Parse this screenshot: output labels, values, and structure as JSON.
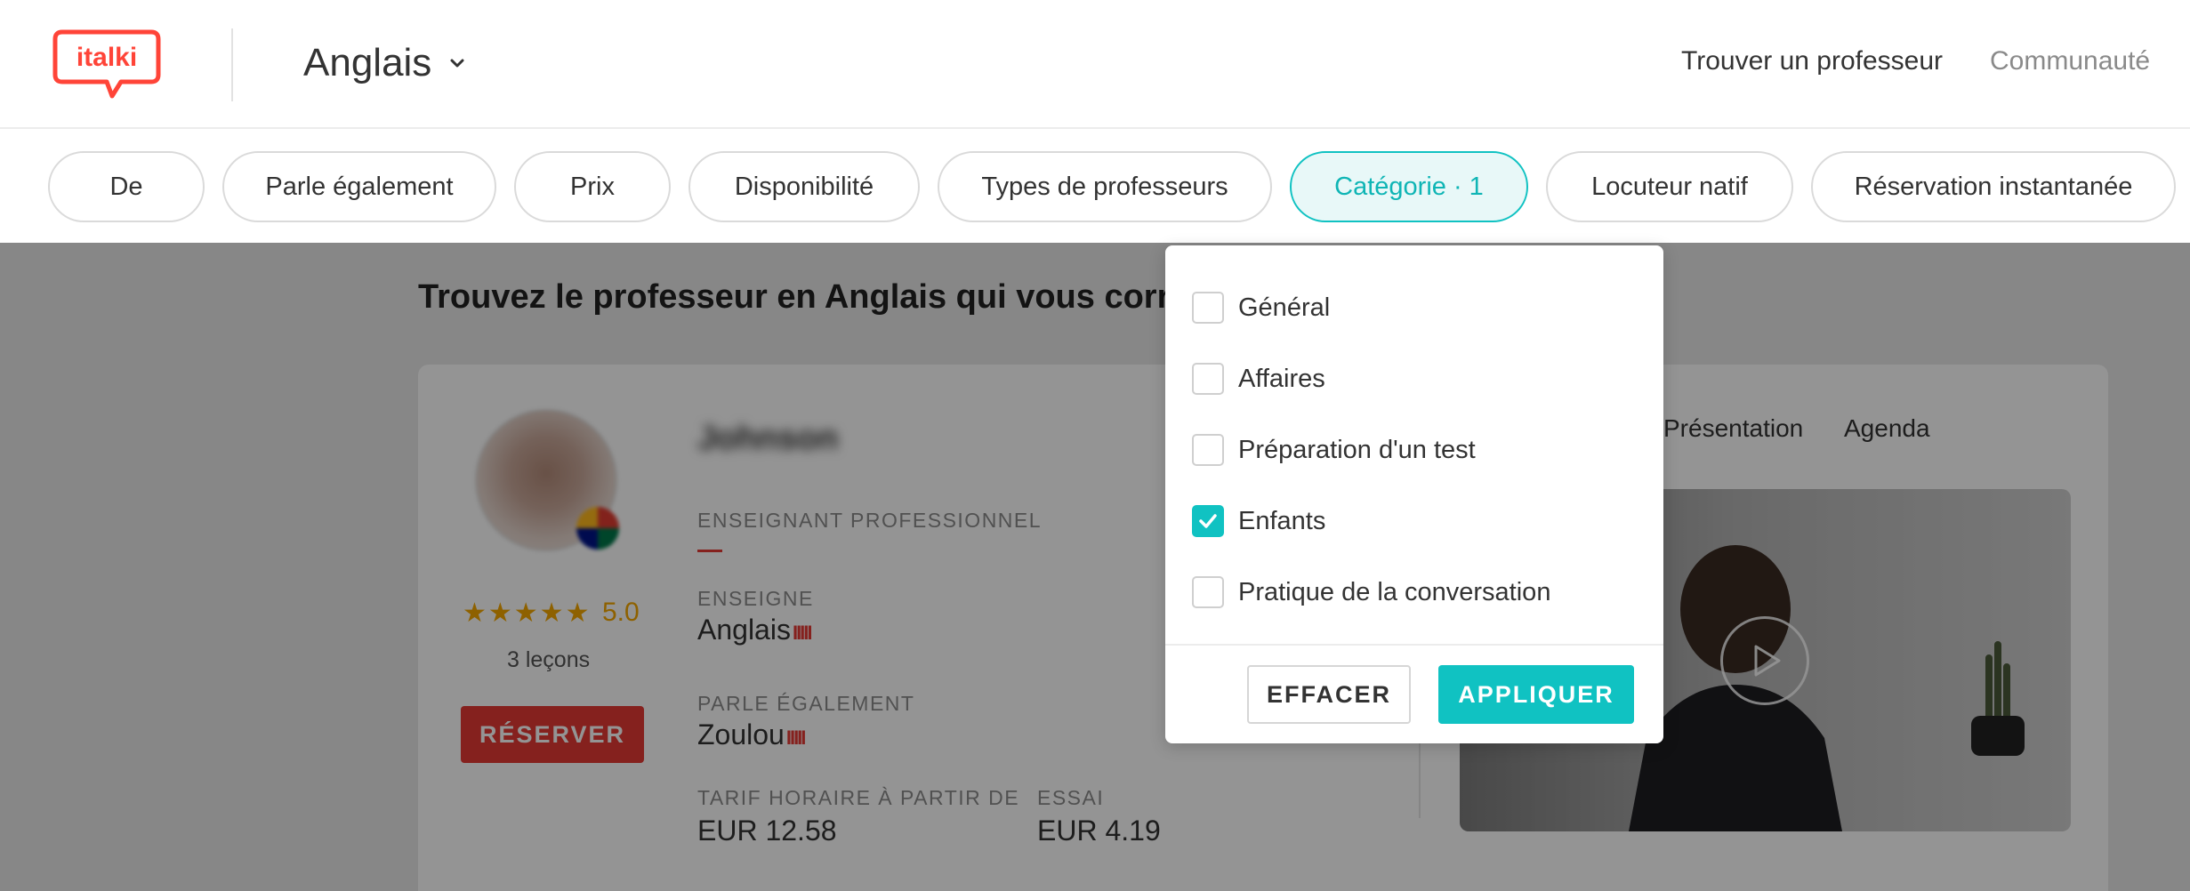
{
  "header": {
    "logo_text": "italki",
    "language": "Anglais",
    "nav": {
      "find_teacher": "Trouver un professeur",
      "community": "Communauté"
    }
  },
  "filters": [
    {
      "label": "De",
      "active": false
    },
    {
      "label": "Parle également",
      "active": false
    },
    {
      "label": "Prix",
      "active": false
    },
    {
      "label": "Disponibilité",
      "active": false
    },
    {
      "label": "Types de professeurs",
      "active": false
    },
    {
      "label": "Catégorie · 1",
      "active": true
    },
    {
      "label": "Locuteur natif",
      "active": false
    },
    {
      "label": "Réservation instantanée",
      "active": false
    }
  ],
  "main": {
    "heading": "Trouvez le professeur en Anglais qui vous corres",
    "teacher": {
      "name": "Johnson",
      "stars": "★★★★★",
      "rating": "5.0",
      "lessons": "3 leçons",
      "reserve_label": "RÉSERVER",
      "type_label": "ENSEIGNANT PROFESSIONNEL",
      "teaches_label": "ENSEIGNE",
      "teaches_value": "Anglais",
      "speaks_label": "PARLE ÉGALEMENT",
      "speaks_value": "Zoulou",
      "level_bars": "IIIII",
      "rate_label": "TARIF HORAIRE À PARTIR DE",
      "rate_value": "EUR 12.58",
      "trial_label": "ESSAI",
      "trial_value": "EUR 4.19",
      "tabs": {
        "presentation": "Présentation",
        "agenda": "Agenda"
      }
    }
  },
  "category_dropdown": {
    "options": [
      {
        "label": "Général",
        "checked": false
      },
      {
        "label": "Affaires",
        "checked": false
      },
      {
        "label": "Préparation d'un test",
        "checked": false
      },
      {
        "label": "Enfants",
        "checked": true
      },
      {
        "label": "Pratique de la conversation",
        "checked": false
      }
    ],
    "clear_label": "EFFACER",
    "apply_label": "APPLIQUER"
  },
  "colors": {
    "brand_red": "#ff4438",
    "accent_teal": "#10c2c2",
    "star_gold": "#f5a800",
    "reserve_red": "#e53935"
  }
}
